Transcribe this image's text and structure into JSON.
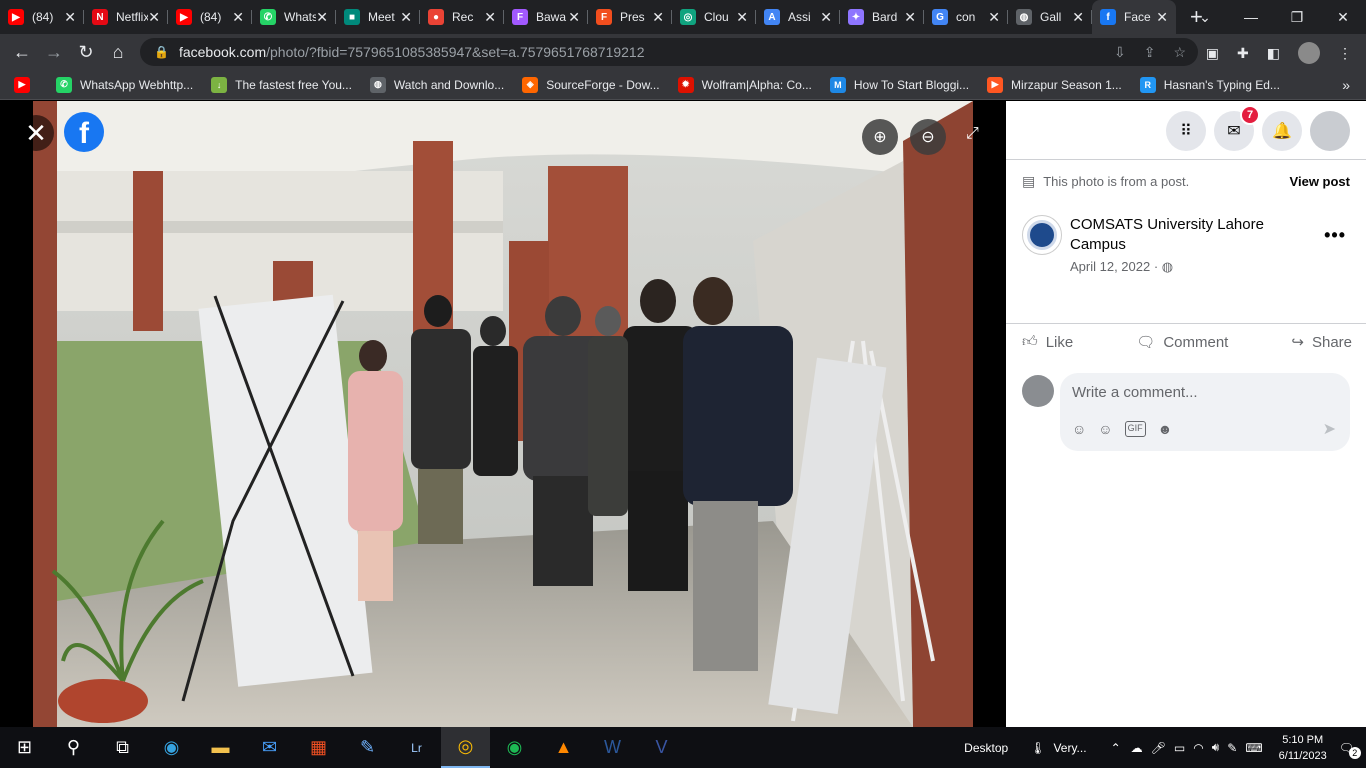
{
  "tabs": [
    {
      "title": "(84)",
      "icon": "youtube-icon",
      "color": "#ff0000",
      "glyph": "▶"
    },
    {
      "title": "Netflix",
      "icon": "netflix-icon",
      "color": "#e50914",
      "glyph": "N"
    },
    {
      "title": "(84)",
      "icon": "youtube-icon",
      "color": "#ff0000",
      "glyph": "▶"
    },
    {
      "title": "WhatsApp",
      "icon": "whatsapp-icon",
      "color": "#25d366",
      "glyph": "✆"
    },
    {
      "title": "Meet",
      "icon": "meet-icon",
      "color": "#00897b",
      "glyph": "■"
    },
    {
      "title": "Rec",
      "icon": "record-icon",
      "color": "#ea4335",
      "glyph": "●"
    },
    {
      "title": "Bawa",
      "icon": "figma-icon",
      "color": "#a259ff",
      "glyph": "F"
    },
    {
      "title": "Pres",
      "icon": "figma-icon",
      "color": "#f24e1e",
      "glyph": "F"
    },
    {
      "title": "Clou",
      "icon": "chatgpt-icon",
      "color": "#10a37f",
      "glyph": "◎"
    },
    {
      "title": "Assi",
      "icon": "classroom-icon",
      "color": "#4285f4",
      "glyph": "A"
    },
    {
      "title": "Bard",
      "icon": "bard-icon",
      "color": "#8e75ff",
      "glyph": "✦"
    },
    {
      "title": "con",
      "icon": "google-icon",
      "color": "#4285f4",
      "glyph": "G"
    },
    {
      "title": "Gall",
      "icon": "globe-icon",
      "color": "#5f6368",
      "glyph": "◍"
    },
    {
      "title": "Face",
      "icon": "facebook-icon",
      "color": "#1877f2",
      "glyph": "f"
    }
  ],
  "url": {
    "host": "facebook.com",
    "path": "/photo/?fbid=7579651085385947&set=a.7579651768719212"
  },
  "bookmarks": [
    {
      "label": "WhatsApp Webhttp...",
      "color": "#25d366",
      "glyph": "✆"
    },
    {
      "label": "The fastest free You...",
      "color": "#7cb342",
      "glyph": "↓"
    },
    {
      "label": "Watch and Downlo...",
      "color": "#5f6368",
      "glyph": "◍"
    },
    {
      "label": "SourceForge - Dow...",
      "color": "#ff6600",
      "glyph": "◈"
    },
    {
      "label": "Wolfram|Alpha: Co...",
      "color": "#dd1100",
      "glyph": "✹"
    },
    {
      "label": "How To Start Bloggi...",
      "color": "#1e88e5",
      "glyph": "M"
    },
    {
      "label": "Mirzapur Season 1...",
      "color": "#ff5722",
      "glyph": "▶"
    },
    {
      "label": "Hasnan's Typing Ed...",
      "color": "#2196f3",
      "glyph": "R"
    }
  ],
  "panel": {
    "notification_count": "7",
    "post_note": "This photo is from a post.",
    "view_post": "View post",
    "author": "COMSATS University Lahore Campus",
    "date": "April 12, 2022 ·",
    "like": "Like",
    "comment": "Comment",
    "share": "Share",
    "comment_placeholder": "Write a comment...",
    "gif": "GIF"
  },
  "taskbar": {
    "desktop": "Desktop",
    "weather": "Very...",
    "time": "5:10 PM",
    "date": "6/11/2023",
    "notifications": "2"
  },
  "colors": {
    "facebook_blue": "#1877f2",
    "badge_red": "#e41e3f",
    "chrome_dark": "#202124",
    "chrome_toolbar": "#35363a"
  }
}
